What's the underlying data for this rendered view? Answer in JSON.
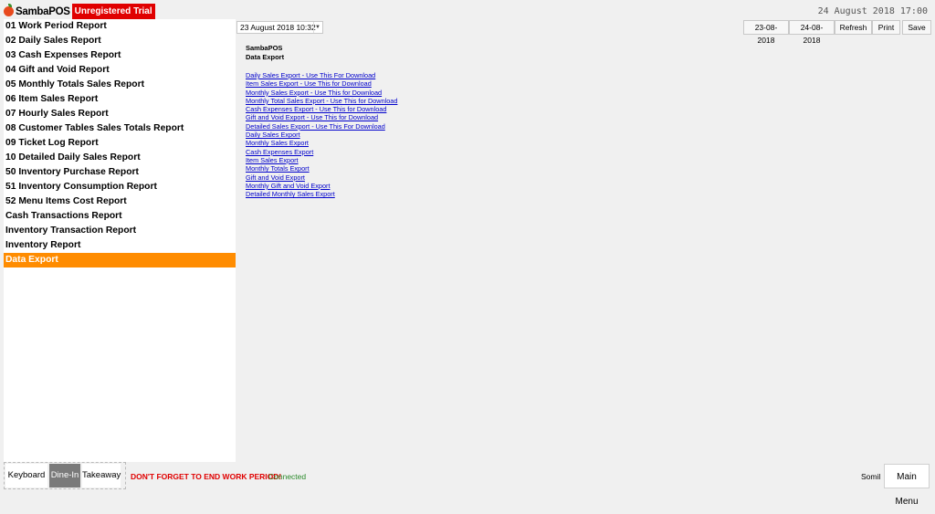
{
  "header": {
    "app_name": "SambaPOS",
    "trial_badge": "Unregistered Trial",
    "clock": "24 August 2018 17:00"
  },
  "sidebar": {
    "items": [
      {
        "label": "01 Work Period Report",
        "active": false
      },
      {
        "label": "02 Daily Sales Report",
        "active": false
      },
      {
        "label": "03 Cash Expenses Report",
        "active": false
      },
      {
        "label": "04 Gift and Void Report",
        "active": false
      },
      {
        "label": "05 Monthly Totals Sales Report",
        "active": false
      },
      {
        "label": "06 Item Sales Report",
        "active": false
      },
      {
        "label": "07 Hourly Sales Report",
        "active": false
      },
      {
        "label": "08 Customer Tables Sales Totals Report",
        "active": false
      },
      {
        "label": "09 Ticket Log Report",
        "active": false
      },
      {
        "label": "10 Detailed Daily Sales Report",
        "active": false
      },
      {
        "label": "50 Inventory Purchase Report",
        "active": false
      },
      {
        "label": "51 Inventory Consumption Report",
        "active": false
      },
      {
        "label": "52 Menu Items Cost Report",
        "active": false
      },
      {
        "label": "Cash Transactions Report",
        "active": false
      },
      {
        "label": "Inventory Transaction Report",
        "active": false
      },
      {
        "label": "Inventory Report",
        "active": false
      },
      {
        "label": "Data Export",
        "active": true
      }
    ]
  },
  "toolbar": {
    "period_value": "23 August 2018 10:32",
    "start_date": "23-08-2018",
    "end_date": "24-08-2018",
    "refresh_label": "Refresh",
    "print_label": "Print",
    "save_label": "Save"
  },
  "document": {
    "title": "SambaPOS",
    "subtitle": "Data Export",
    "links": [
      "Daily Sales Export - Use This For Download",
      "Item Sales Export - Use This for Download",
      "Monthly Sales Export - Use This for Download",
      "Monthly Total Sales Export - Use This for Download",
      "Cash Expenses Export - Use This for Download",
      "Gift and Void Export - Use This for Download",
      "Detailed Sales Export - Use This For Download",
      "Daily Sales Export",
      "Monthly Sales Export",
      "Cash Expenses Export",
      "Item Sales Export",
      "Monthly Totals Export",
      "Gift and Void Export",
      "Monthly Gift and Void Export",
      "Detailed Monthly Sales Export"
    ]
  },
  "footer": {
    "ticket_types": [
      {
        "label": "Keyboard",
        "selected": false
      },
      {
        "label": "Dine-In",
        "selected": true
      },
      {
        "label": "Takeaway",
        "selected": false
      }
    ],
    "warning": "DON'T FORGET TO END WORK PERIOD!",
    "connection_status": "Connected",
    "user_name": "Somil",
    "main_menu_label": "Main Menu"
  },
  "colors": {
    "accent": "#ff8c00",
    "trial_badge": "#e00000",
    "warning": "#e00000",
    "connected": "#2a8a2a",
    "link": "#0000cc"
  }
}
